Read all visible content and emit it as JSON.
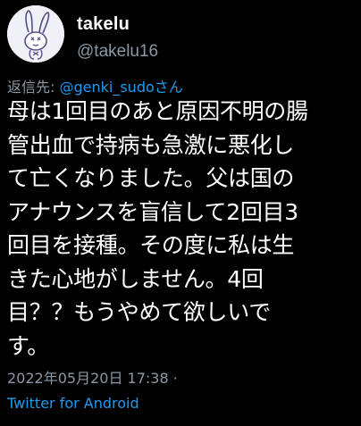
{
  "user": {
    "display_name": "takelu",
    "handle": "@takelu16",
    "avatar": "bunny-doodle-avatar"
  },
  "reply": {
    "prefix": "返信先: ",
    "mention": "@genki_sudo",
    "suffix": "さん"
  },
  "tweet": {
    "lines": [
      "母は1回目のあと原因不明の腸",
      "管出血で持病も急激に悪化し",
      "て亡くなりました。父は国の",
      "アナウンスを盲信して2回目3",
      "回目を接種。その度に私は生",
      "きた心地がしません。4回",
      "目？？もうやめて欲しいで",
      "す。"
    ]
  },
  "meta": {
    "timestamp": "2022年05月20日 17:38 ·",
    "source": "Twitter for Android"
  },
  "colors": {
    "background": "#000000",
    "text": "#ffffff",
    "secondary": "#8b98a5",
    "link": "#1d9bf0"
  }
}
